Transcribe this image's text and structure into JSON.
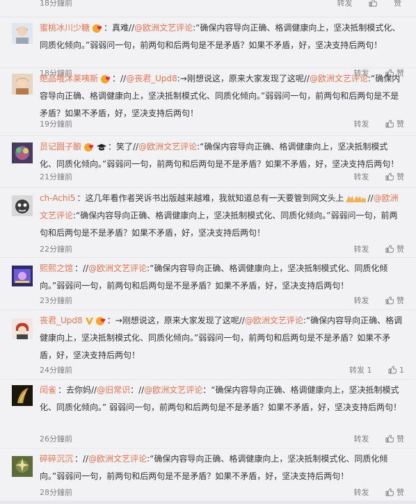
{
  "top": {
    "time": "18分鐘前",
    "repost": "转发",
    "like": "赞"
  },
  "comments": [
    {
      "username": "蜜桃冰川少糖",
      "segments": [
        {
          "t": "：真难//",
          "m": false
        },
        {
          "t": "@欧洲文艺评论",
          "m": true
        },
        {
          "t": ":“确保内容导向正确、格调健康向上，坚决抵制模式化、同质化倾向。”弱弱问一句，前两句和后两句是不是矛盾？如果不矛盾，好，坚决支持后两句！",
          "m": false
        }
      ],
      "time": "18分鐘前",
      "repost": "转发",
      "like": "赞",
      "avatar_color": "#9aa6b4"
    },
    {
      "username": "绝品哦沐莱咦斯",
      "segments": [
        {
          "t": "：//",
          "m": false
        },
        {
          "t": "@丧君_Upd8",
          "m": true
        },
        {
          "t": ":→刚想说这，原来大家发现了这呢//",
          "m": false
        },
        {
          "t": "@欧洲文艺评论",
          "m": true
        },
        {
          "t": ":“确保内容导向正确、格调健康向上，坚决抵制模式化、同质化倾向。”弱弱问一句，前两句和后两句是不是矛盾？如果不矛盾，好，坚决支持后两句！",
          "m": false
        }
      ],
      "time": "19分鐘前",
      "repost": "转发",
      "like": "赞",
      "avatar_color": "#c7a17a"
    },
    {
      "username": "员记圆子酿",
      "segments": [
        {
          "t": "：笑了//",
          "m": false
        },
        {
          "t": "@欧洲文艺评论",
          "m": true
        },
        {
          "t": ":“确保内容导向正确、格调健康向上，坚决抵制模式化、同质化倾向。”弱弱问一句，前两句和后两句是不是矛盾？如果不矛盾，好，坚决支持后两句！",
          "m": false
        }
      ],
      "time": "21分鐘前",
      "repost": "转发",
      "like": "赞",
      "avatar_color": "#8a6aa6"
    },
    {
      "username": "ch-Achi5",
      "segments": [
        {
          "t": "：这几年看作者哭诉书出版越来越难，我就知道总有一天要管到网文头上",
          "m": false
        },
        {
          "t": "//",
          "m": false
        },
        {
          "t": "@欧洲文艺评论",
          "m": true
        },
        {
          "t": ":“确保内容导向正确、格调健康向上，坚决抵制模式化、同质化倾向。”弱弱问一句，前两句和后两句是不是矛盾？如果不矛盾，好，坚决支持后两句！",
          "m": false
        }
      ],
      "time": "22分鐘前",
      "repost": "转发",
      "like": "赞",
      "avatar_color": "#3b3b3b"
    },
    {
      "username": "熙熙之馆",
      "segments": [
        {
          "t": "：//",
          "m": false
        },
        {
          "t": "@欧洲文艺评论",
          "m": true
        },
        {
          "t": ":“确保内容导向正确、格调健康向上，坚决抵制模式化、同质化倾向。”弱弱问一句，前两句和后两句是不是矛盾？如果不矛盾，好，坚决支持后两句！",
          "m": false
        }
      ],
      "time": "23分鐘前",
      "repost": "转发",
      "like": "赞",
      "avatar_color": "#6e5bd6"
    },
    {
      "username": "丧君_Upd8",
      "segments": [
        {
          "t": "：→刚想说这，原来大家发现了这呢//",
          "m": false
        },
        {
          "t": "@欧洲文艺评论",
          "m": true
        },
        {
          "t": ":“确保内容导向正确、格调健康向上，坚决抵制模式化、同质化倾向。”弱弱问一句，前两句和后两句是不是矛盾？如果不矛盾，好，坚决支持后两句！",
          "m": false
        }
      ],
      "time": "24分鐘前",
      "repost": "转发 1",
      "like": "1",
      "avatar_color": "#c0392b"
    },
    {
      "username": "闰雀",
      "segments": [
        {
          "t": "：去你妈//",
          "m": false
        },
        {
          "t": "@旧常识",
          "m": true
        },
        {
          "t": "：//",
          "m": false
        },
        {
          "t": "@欧洲文艺评论",
          "m": true
        },
        {
          "t": "：“确保内容导向正确、格调健康向上，坚决抵制模式化、同质化倾向。” 弱弱问一句，前两句和后两句是不是矛盾？如果不矛盾，好，坚决支持后两句！",
          "m": false
        }
      ],
      "time": "26分鐘前",
      "repost": "转发",
      "like": "赞",
      "avatar_color": "#2a2410"
    },
    {
      "username": "碎碎沉沉",
      "segments": [
        {
          "t": "：//",
          "m": false
        },
        {
          "t": "@欧洲文艺评论",
          "m": true
        },
        {
          "t": ":“确保内容导向正确、格调健康向上，坚决抵制模式化、同质化倾向。”弱弱问一句，前两句和后两句是不是矛盾？如果不矛盾，好，坚决支持后两句！",
          "m": false
        }
      ],
      "time": "28分鐘前",
      "repost": "转发",
      "like": "赞",
      "avatar_color": "#7f8c4a"
    }
  ]
}
